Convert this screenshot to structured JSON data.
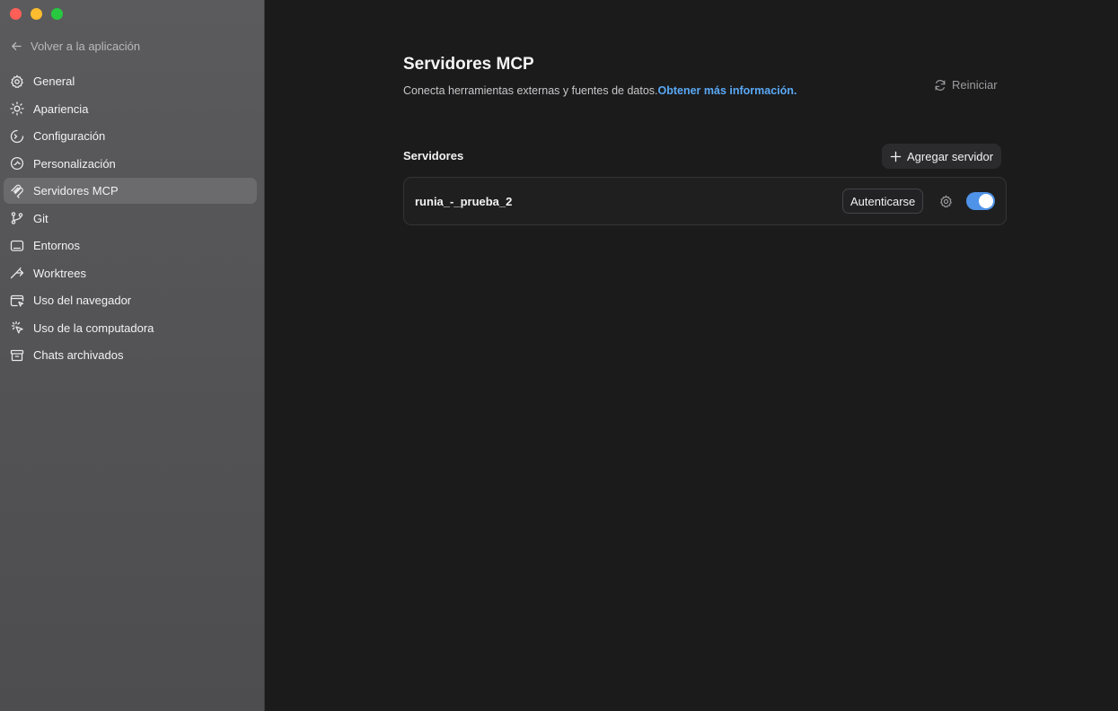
{
  "window": {
    "controls": [
      "close",
      "minimize",
      "zoom"
    ]
  },
  "sidebar": {
    "back_label": "Volver a la aplicación",
    "items": [
      {
        "label": "General",
        "icon": "gear-icon",
        "active": false
      },
      {
        "label": "Apariencia",
        "icon": "sun-icon",
        "active": false
      },
      {
        "label": "Configuración",
        "icon": "shield-icon",
        "active": false
      },
      {
        "label": "Personalización",
        "icon": "clock-icon",
        "active": false
      },
      {
        "label": "Servidores MCP",
        "icon": "mcp-icon",
        "active": true
      },
      {
        "label": "Git",
        "icon": "git-branch-icon",
        "active": false
      },
      {
        "label": "Entornos",
        "icon": "monitor-icon",
        "active": false
      },
      {
        "label": "Worktrees",
        "icon": "worktree-icon",
        "active": false
      },
      {
        "label": "Uso del navegador",
        "icon": "browser-icon",
        "active": false
      },
      {
        "label": "Uso de la computadora",
        "icon": "cursor-icon",
        "active": false
      },
      {
        "label": "Chats archivados",
        "icon": "archive-icon",
        "active": false
      }
    ]
  },
  "main": {
    "title": "Servidores MCP",
    "subtitle": "Conecta herramientas externas y fuentes de datos.",
    "link": "Obtener más información.",
    "restart_label": "Reiniciar",
    "servers_label": "Servidores",
    "add_server_label": "Agregar servidor",
    "servers": [
      {
        "name": "runia_-_prueba_2",
        "auth_label": "Autenticarse",
        "enabled": true
      }
    ]
  },
  "colors": {
    "accent": "#4f93e8",
    "link": "#5aa9f5",
    "background": "#1b1b1c",
    "sidebar": "#545456"
  }
}
